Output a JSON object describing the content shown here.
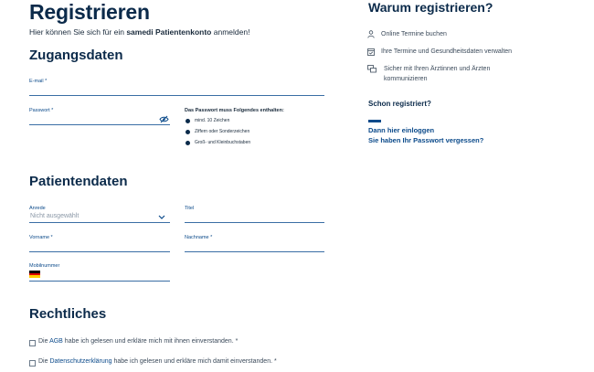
{
  "title": "Registrieren",
  "intro": {
    "prefix": "Hier können Sie sich für ein ",
    "bold": "samedi Patientenkonto",
    "suffix": " anmelden!"
  },
  "zugang": {
    "heading": "Zugangsdaten",
    "email_label": "E-mail *",
    "password_label": "Passwort *",
    "pw_rules_title": "Das Passwort muss Folgendes enthalten:",
    "pw_rules": [
      "mind. 10 Zeichen",
      "Ziffern oder Sonderzeichen",
      "Groß- und Kleinbuchstaben"
    ]
  },
  "patient": {
    "heading": "Patientendaten",
    "anrede_label": "Anrede",
    "anrede_value": "Nicht ausgewählt",
    "titel_label": "Titel",
    "vorname_label": "Vorname *",
    "nachname_label": "Nachname *",
    "mobil_label": "Mobilnummer"
  },
  "recht": {
    "heading": "Rechtliches",
    "agb_prefix": "Die ",
    "agb_link": "AGB",
    "agb_suffix": " habe ich gelesen und erkläre mich mit ihnen einverstanden. *",
    "ds_prefix": "Die ",
    "ds_link": "Datenschutzerklärung",
    "ds_suffix": " habe ich gelesen und erkläre mich damit einverstanden. *"
  },
  "side": {
    "heading": "Warum registrieren?",
    "items": [
      "Online Termine buchen",
      "Ihre Termine und Gesundheitsdaten verwalten",
      "Sicher mit Ihren Ärztinnen und Ärzten",
      "kommunizieren"
    ],
    "already": "Schon registriert?",
    "login_link": "Dann hier einloggen",
    "forgot_link": "Sie haben Ihr Passwort vergessen?"
  },
  "colors": {
    "accent": "#0b4a8a",
    "heading": "#0b2a4a"
  }
}
